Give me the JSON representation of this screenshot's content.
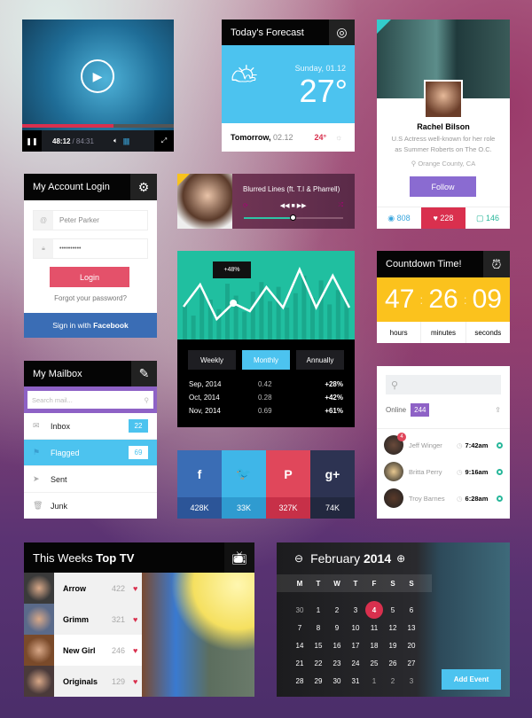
{
  "video": {
    "current_time": "48:12",
    "total_time": "/ 84:31",
    "progress": 0.6,
    "volume": 0.8
  },
  "weather": {
    "title": "Today's Forecast",
    "date": "Sunday, 01.12",
    "temp": "27°",
    "tomorrow_label": "Tomorrow,",
    "tomorrow_date": "02.12",
    "tomorrow_temp": "24°",
    "colors": {
      "sky": "#4cc3ef",
      "hot": "#d8304d"
    }
  },
  "profile": {
    "name": "Rachel Bilson",
    "description": "U.S Actress well-known for her role as Summer Roberts on The O.C.",
    "location": "Orange County, CA",
    "follow_label": "Follow",
    "views": "808",
    "likes": "228",
    "comments": "146",
    "colors": {
      "follow": "#8a6bd1",
      "likes": "#d9304e",
      "views": "#3aa6de",
      "comments": "#27b79a"
    }
  },
  "login": {
    "title": "My Account Login",
    "username": "Peter Parker",
    "password": "••••••••••",
    "login_label": "Login",
    "forgot_label": "Forgot your password?",
    "facebook_prefix": "Sign in with ",
    "facebook_brand": "Facebook"
  },
  "music": {
    "track": "Blurred Lines (ft. T.I & Pharrell)",
    "progress": 0.5
  },
  "stats": {
    "tooltip": "+48%",
    "tabs": [
      {
        "label": "Weekly"
      },
      {
        "label": "Monthly",
        "active": true
      },
      {
        "label": "Annually"
      }
    ],
    "rows": [
      {
        "date": "Sep, 2014",
        "value": "0.42",
        "change": "+28%"
      },
      {
        "date": "Oct, 2014",
        "value": "0.28",
        "change": "+42%"
      },
      {
        "date": "Nov, 2014",
        "value": "0.69",
        "change": "+61%"
      }
    ]
  },
  "chart_data": {
    "type": "line",
    "line_values": [
      37,
      62,
      23,
      41,
      32,
      59,
      36,
      79,
      36,
      72,
      36
    ],
    "highlight_index": 3,
    "bar_values": [
      45,
      30,
      62,
      50,
      38,
      70,
      55,
      35,
      60,
      72,
      48,
      66,
      40,
      58,
      80,
      52,
      74,
      44,
      62,
      50
    ],
    "ylim": [
      0,
      100
    ]
  },
  "countdown": {
    "title": "Countdown Time!",
    "hours": "47",
    "minutes": "26",
    "seconds": "09",
    "labels": [
      "hours",
      "minutes",
      "seconds"
    ]
  },
  "mailbox": {
    "title": "My Mailbox",
    "search_placeholder": "Search mail...",
    "items": [
      {
        "label": "Inbox",
        "count": "22",
        "icon": "envelope-icon"
      },
      {
        "label": "Flagged",
        "count": "69",
        "icon": "flag-icon",
        "active": true
      },
      {
        "label": "Sent",
        "icon": "paper-plane-icon"
      },
      {
        "label": "Junk",
        "icon": "trash-icon"
      }
    ]
  },
  "social": [
    {
      "icon": "f",
      "count": "428K",
      "name": "facebook",
      "color": "#3a6db5",
      "dark": "#2c5598"
    },
    {
      "icon": "🐦",
      "count": "33K",
      "name": "twitter",
      "color": "#3fb6e8",
      "dark": "#2f9bd0"
    },
    {
      "icon": "P",
      "count": "327K",
      "name": "pinterest",
      "color": "#e0475b",
      "dark": "#c73048"
    },
    {
      "icon": "g+",
      "count": "74K",
      "name": "google-plus",
      "color": "#2d3352",
      "dark": "#22283f"
    }
  ],
  "chat": {
    "online_label": "Online",
    "online_count": "244",
    "users": [
      {
        "name": "Jeff Winger",
        "time": "7:42am",
        "badge": "4"
      },
      {
        "name": "Britta Perry",
        "time": "9:16am"
      },
      {
        "name": "Troy Barnes",
        "time": "6:28am"
      }
    ]
  },
  "toptv": {
    "title_prefix": "This Weeks ",
    "title_bold": "Top TV",
    "shows": [
      {
        "name": "Arrow",
        "likes": "422"
      },
      {
        "name": "Grimm",
        "likes": "321"
      },
      {
        "name": "New Girl",
        "likes": "246",
        "active": true
      },
      {
        "name": "Originals",
        "likes": "129"
      }
    ]
  },
  "calendar": {
    "month": "February",
    "year": "2014",
    "weekdays": [
      "M",
      "T",
      "W",
      "T",
      "F",
      "S",
      "S"
    ],
    "selected": "4",
    "add_event_label": "Add Event",
    "weeks": [
      [
        "30",
        "1",
        "2",
        "3",
        "4",
        "5",
        "6"
      ],
      [
        "7",
        "8",
        "9",
        "10",
        "11",
        "12",
        "13"
      ],
      [
        "14",
        "15",
        "16",
        "17",
        "18",
        "19",
        "20"
      ],
      [
        "21",
        "22",
        "23",
        "24",
        "25",
        "26",
        "27"
      ],
      [
        "28",
        "29",
        "30",
        "31",
        "1",
        "2",
        "3"
      ]
    ]
  }
}
